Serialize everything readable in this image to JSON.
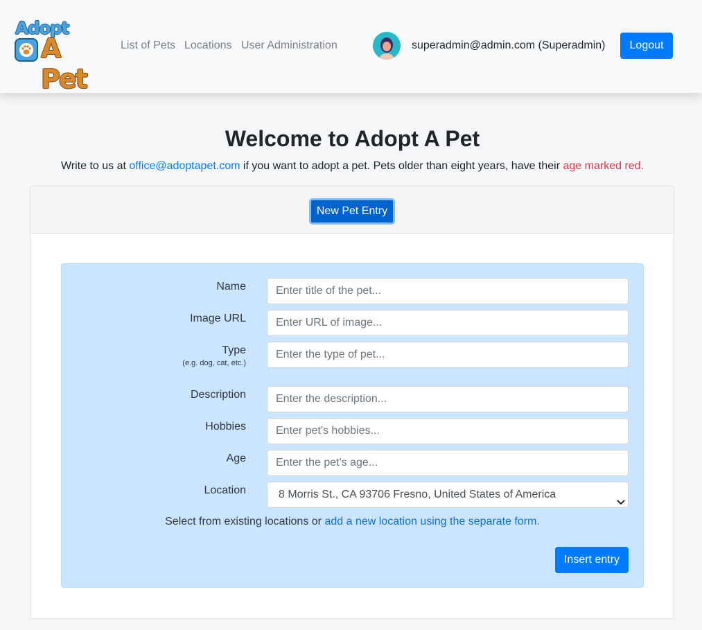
{
  "brand": {
    "line1": "Adopt",
    "line2": "A Pet"
  },
  "nav": {
    "links": [
      {
        "label": "List of Pets"
      },
      {
        "label": "Locations"
      },
      {
        "label": "User Administration"
      }
    ],
    "user": "superadmin@admin.com (Superadmin)",
    "logout_label": "Logout"
  },
  "page": {
    "title": "Welcome to Adopt A Pet",
    "intro_pre": "Write to us at ",
    "intro_email": "office@adoptapet.com",
    "intro_mid": " if you want to adopt a pet. Pets older than eight years, have their ",
    "intro_red": "age marked red."
  },
  "card": {
    "new_entry_label": "New Pet Entry"
  },
  "form": {
    "fields": [
      {
        "label": "Name",
        "placeholder": "Enter title of the pet..."
      },
      {
        "label": "Image URL",
        "placeholder": "Enter URL of image..."
      },
      {
        "label": "Type",
        "hint": "(e.g. dog, cat, etc.)",
        "placeholder": "Enter the type of pet..."
      },
      {
        "label": "Description",
        "placeholder": "Enter the description..."
      },
      {
        "label": "Hobbies",
        "placeholder": "Enter pet's hobbies..."
      },
      {
        "label": "Age",
        "placeholder": "Enter the pet's age..."
      }
    ],
    "location": {
      "label": "Location",
      "selected": "8 Morris St., CA 93706 Fresno, United States of America"
    },
    "helper_pre": "Select from existing locations or ",
    "helper_link": "add a new location using the separate form.",
    "submit_label": "Insert entry"
  },
  "colors": {
    "primary": "#007bff",
    "panel": "#cce5ff",
    "danger": "#dc3545"
  }
}
